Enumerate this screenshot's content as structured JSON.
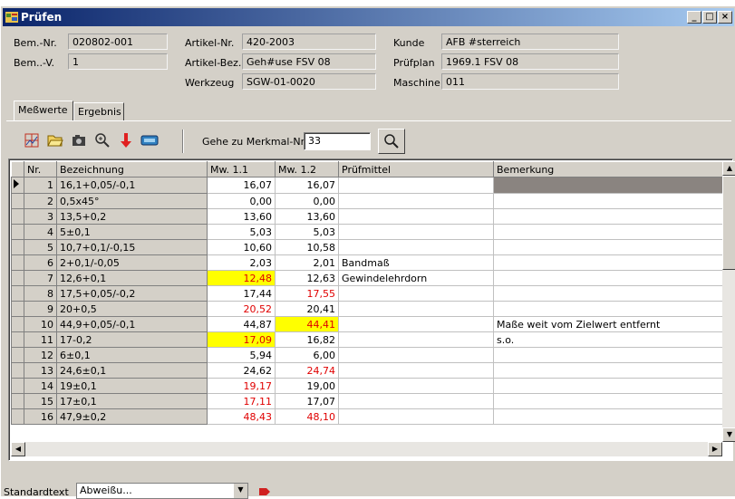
{
  "window": {
    "title": "Prüfen",
    "buttons": {
      "minimize": "_",
      "maximize": "□",
      "close": "×"
    }
  },
  "header": {
    "bem_nr": {
      "label": "Bem.-Nr.",
      "value": "020802-001"
    },
    "bem_v": {
      "label": "Bem..-V.",
      "value": "1"
    },
    "artikel_nr": {
      "label": "Artikel-Nr.",
      "value": "420-2003"
    },
    "artikel_bez": {
      "label": "Artikel-Bez.",
      "value": "Geh#use FSV 08"
    },
    "werkzeug": {
      "label": "Werkzeug",
      "value": "SGW-01-0020"
    },
    "kunde": {
      "label": "Kunde",
      "value": "AFB #sterreich"
    },
    "pruefplan": {
      "label": "Prüfplan",
      "value": "1969.1 FSV 08"
    },
    "maschine": {
      "label": "Maschine",
      "value": "011"
    }
  },
  "tabs": [
    {
      "label": "Meßwerte",
      "active": true
    },
    {
      "label": "Ergebnis",
      "active": false
    }
  ],
  "toolbar": {
    "icons": [
      "chart-icon",
      "folder-open-icon",
      "camera-icon",
      "zoom-icon",
      "down-arrow-icon",
      "ruler-icon"
    ],
    "goto_label": "Gehe zu Merkmal-Nr.",
    "goto_value": "33",
    "search_icon": "search-icon"
  },
  "grid": {
    "columns": [
      "Nr.",
      "Bezeichnung",
      "Mw. 1.1",
      "Mw. 1.2",
      "Prüfmittel",
      "Bemerkung"
    ],
    "rows": [
      {
        "nr": "1",
        "bez": "16,1+0,05/-0,1",
        "mw11": "16,07",
        "mw12": "16,07",
        "pm": "",
        "bem": ""
      },
      {
        "nr": "2",
        "bez": "0,5x45°",
        "mw11": "0,00",
        "mw12": "0,00",
        "pm": "",
        "bem": ""
      },
      {
        "nr": "3",
        "bez": "13,5+0,2",
        "mw11": "13,60",
        "mw12": "13,60",
        "pm": "",
        "bem": ""
      },
      {
        "nr": "4",
        "bez": "5±0,1",
        "mw11": "5,03",
        "mw12": "5,03",
        "pm": "",
        "bem": ""
      },
      {
        "nr": "5",
        "bez": "10,7+0,1/-0,15",
        "mw11": "10,60",
        "mw12": "10,58",
        "pm": "",
        "bem": ""
      },
      {
        "nr": "6",
        "bez": "2+0,1/-0,05",
        "mw11": "2,03",
        "mw12": "2,01",
        "pm": "Bandmaß",
        "bem": ""
      },
      {
        "nr": "7",
        "bez": "12,6+0,1",
        "mw11": "12,48",
        "mw12": "12,63",
        "pm": "Gewindelehrdorn",
        "bem": ""
      },
      {
        "nr": "8",
        "bez": "17,5+0,05/-0,2",
        "mw11": "17,44",
        "mw12": "17,55",
        "pm": "",
        "bem": ""
      },
      {
        "nr": "9",
        "bez": "20+0,5",
        "mw11": "20,52",
        "mw12": "20,41",
        "pm": "",
        "bem": ""
      },
      {
        "nr": "10",
        "bez": "44,9+0,05/-0,1",
        "mw11": "44,87",
        "mw12": "44,41",
        "pm": "",
        "bem": "Maße weit vom Zielwert entfernt"
      },
      {
        "nr": "11",
        "bez": "17-0,2",
        "mw11": "17,09",
        "mw12": "16,82",
        "pm": "",
        "bem": "s.o."
      },
      {
        "nr": "12",
        "bez": "6±0,1",
        "mw11": "5,94",
        "mw12": "6,00",
        "pm": "",
        "bem": ""
      },
      {
        "nr": "13",
        "bez": "24,6±0,1",
        "mw11": "24,62",
        "mw12": "24,74",
        "pm": "",
        "bem": ""
      },
      {
        "nr": "14",
        "bez": "19±0,1",
        "mw11": "19,17",
        "mw12": "19,00",
        "pm": "",
        "bem": ""
      },
      {
        "nr": "15",
        "bez": "17±0,1",
        "mw11": "17,11",
        "mw12": "17,07",
        "pm": "",
        "bem": ""
      },
      {
        "nr": "16",
        "bez": "47,9±0,2",
        "mw11": "48,43",
        "mw12": "48,10",
        "pm": "",
        "bem": ""
      }
    ]
  },
  "status": {
    "label": "Standardtext",
    "combo_value": "Abweißu..."
  }
}
